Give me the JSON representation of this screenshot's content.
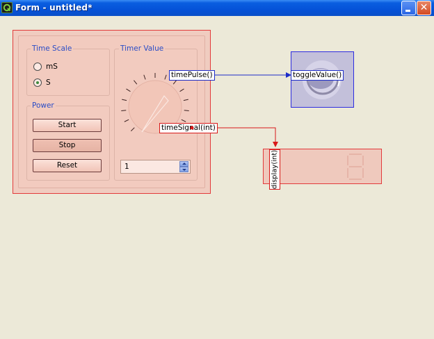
{
  "window": {
    "title": "Form - untitled*"
  },
  "time_scale": {
    "title": "Time Scale",
    "options": [
      {
        "label": "mS",
        "checked": false
      },
      {
        "label": "S",
        "checked": true
      }
    ]
  },
  "power": {
    "title": "Power",
    "buttons": [
      {
        "label": "Start",
        "pressed": false
      },
      {
        "label": "Stop",
        "pressed": true
      },
      {
        "label": "Reset",
        "pressed": false
      }
    ]
  },
  "timer_value": {
    "title": "Timer Value",
    "spin_value": "1"
  },
  "connections": {
    "time_pulse": "timePulse()",
    "toggle_value": "toggleValue()",
    "time_signal": "timeSignal(int)",
    "display": "display(int)"
  },
  "colors": {
    "signal_blue": "#1c2cc8",
    "signal_red": "#d81818",
    "widget_fill": "#f0ccc0",
    "toggle_fill": "#c3c0da"
  },
  "icons": [
    "app-icon",
    "minimize-icon",
    "close-icon",
    "dial-icon",
    "led-toggle-icon",
    "lcd-digit-icon",
    "spin-up-icon",
    "spin-down-icon"
  ]
}
